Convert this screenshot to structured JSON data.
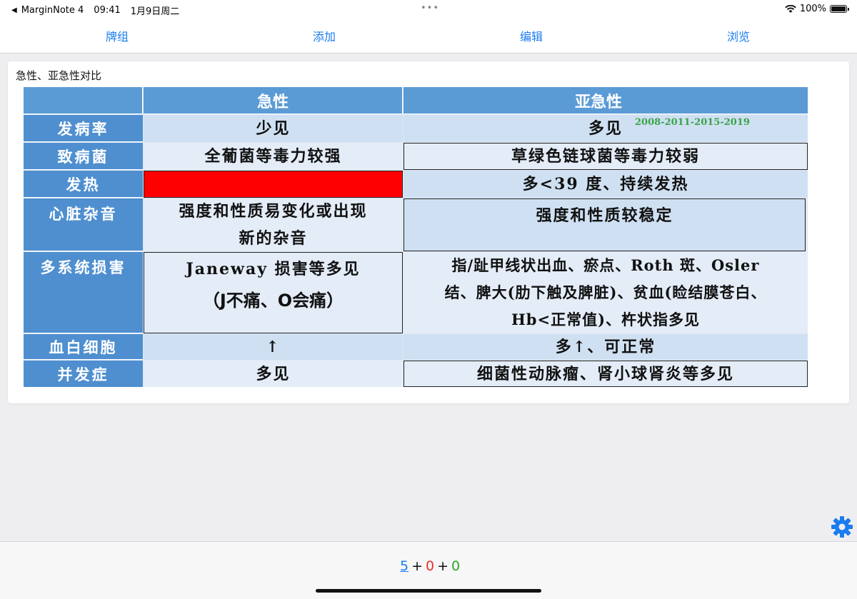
{
  "status_bar": {
    "back_app": "MarginNote 4",
    "time": "09:41",
    "date": "1月9日周二",
    "battery": "100%"
  },
  "nav": {
    "tabs": [
      "牌组",
      "添加",
      "编辑",
      "浏览"
    ]
  },
  "card": {
    "title": "急性、亚急性对比",
    "header": {
      "acute": "急性",
      "subacute": "亚急性",
      "years": "2008-2011-2015-2019"
    },
    "rows": [
      {
        "label": "发病率",
        "acute": "少见",
        "subacute": "多见"
      },
      {
        "label": "致病菌",
        "acute": "全葡菌等毒力较强",
        "subacute": "草绿色链球菌等毒力较弱"
      },
      {
        "label": "发热",
        "acute": "",
        "subacute": "多<39 度、持续发热"
      },
      {
        "label": "心脏杂音",
        "acute": [
          "强度和性质易变化或出现",
          "新的杂音"
        ],
        "subacute": "强度和性质较稳定"
      },
      {
        "label": "多系统损害",
        "acute": [
          "Janeway 损害等多见",
          "（J不痛、O会痛）"
        ],
        "subacute": [
          "指/趾甲线状出血、瘀点、Roth 斑、Osler",
          "结、脾大(肋下触及脾脏)、贫血(睑结膜苍白、",
          "Hb<正常值)、杵状指多见"
        ]
      },
      {
        "label": "血白细胞",
        "acute": "↑",
        "subacute": "多↑、可正常"
      },
      {
        "label": "并发症",
        "acute": "多见",
        "subacute": "细菌性动脉瘤、肾小球肾炎等多见"
      }
    ],
    "redacted_color": "#ff0000"
  },
  "counter": {
    "new": "5",
    "plus1": "+",
    "learning": "0",
    "plus2": "+",
    "review": "0"
  },
  "icons": {
    "settings": "gear-icon"
  }
}
